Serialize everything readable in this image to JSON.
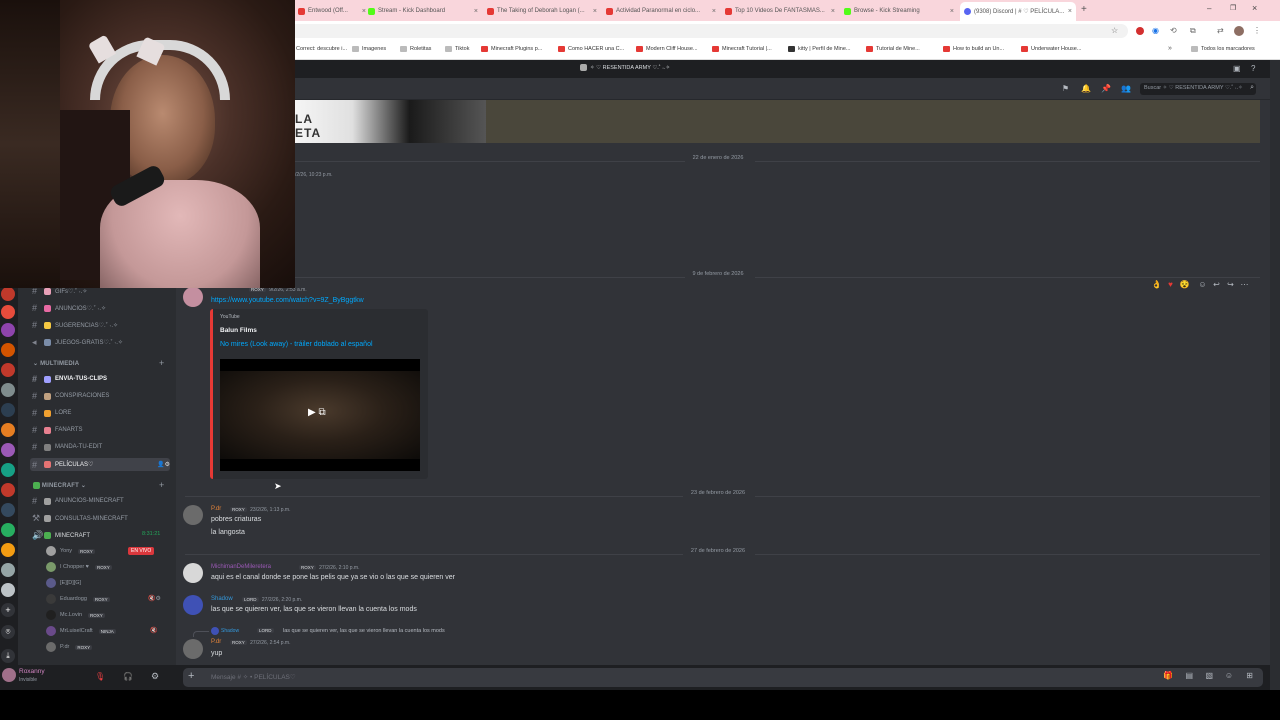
{
  "browser": {
    "tabs": [
      {
        "label": "Entwood (Off...",
        "color": "#e53935"
      },
      {
        "label": "Stream - Kick Dashboard",
        "color": "#53fc18"
      },
      {
        "label": "The Taking of Deborah Logan (...",
        "color": "#e53935"
      },
      {
        "label": "Actividad Paranormal en ciclo...",
        "color": "#e53935"
      },
      {
        "label": "Top 10 Videos De FANTASMAS...",
        "color": "#e53935"
      },
      {
        "label": "Browse - Kick Streaming",
        "color": "#53fc18"
      },
      {
        "label": "(9308) Discord | # ♡ PELÍCULA...",
        "color": "#5865f2"
      }
    ],
    "bookmarks": [
      {
        "label": "Correct: descubre i...",
        "color": "#4285f4"
      },
      {
        "label": "Imagenes",
        "color": "#888"
      },
      {
        "label": "Roletitas",
        "color": "#888"
      },
      {
        "label": "Tiktok",
        "color": "#888"
      },
      {
        "label": "Minecraft Plugins p...",
        "color": "#e53935"
      },
      {
        "label": "Como HACER una C...",
        "color": "#e53935"
      },
      {
        "label": "Modern Cliff House...",
        "color": "#e53935"
      },
      {
        "label": "Minecraft Tutorial |...",
        "color": "#e53935"
      },
      {
        "label": "kitty | Perfil de Mine...",
        "color": "#333"
      },
      {
        "label": "Tutorial de Mine...",
        "color": "#e53935"
      },
      {
        "label": "How to build an Un...",
        "color": "#e53935"
      },
      {
        "label": "Underwater House...",
        "color": "#e53935"
      }
    ],
    "all_bookmarks": "Todos los marcadores"
  },
  "discord": {
    "server_title": "✧ ♡ RESENTIDA ARMY ♡.˚ ˖.✧",
    "search_placeholder": "Buscar ✧ ♡ RESENTIDA ARMY ♡.˚ ˖.✧",
    "channels": [
      {
        "label": "GIFs♡.˚ ˖.✧",
        "emoji_color": "#e8a0b8"
      },
      {
        "label": "ANUNCIOS♡.˚ ˖.✧",
        "emoji_color": "#e86aa3"
      },
      {
        "label": "SUGERENCIAS♡.˚ ˖.✧",
        "emoji_color": "#f5c842"
      },
      {
        "label": "JUEGOS-GRATIS♡.˚ ˖.✧",
        "emoji_color": "#7a8ca8"
      }
    ],
    "cat_multimedia": "MULTIMEDIA",
    "multimedia_channels": [
      {
        "label": "ENVIA-TUS-CLIPS",
        "emoji_color": "#a0a0ff",
        "bold": true
      },
      {
        "label": "CONSPIRACIONES",
        "emoji_color": "#c0a080"
      },
      {
        "label": "LORE",
        "emoji_color": "#f0a030"
      },
      {
        "label": "FANARTS",
        "emoji_color": "#e88090"
      },
      {
        "label": "MANDA-TU-EDIT",
        "emoji_color": "#808080"
      },
      {
        "label": "PELÍCULAS♡",
        "emoji_color": "#e57373",
        "active": true
      }
    ],
    "cat_minecraft": "MINECRAFT",
    "minecraft_channels": [
      {
        "label": "ANUNCIOS-MINECRAFT",
        "emoji_color": "#a0a0a0"
      },
      {
        "label": "CONSULTAS-MINECRAFT",
        "emoji_color": "#a0a0a0"
      }
    ],
    "voice_channel": {
      "label": "MINECRAFT",
      "timer": "8:31:21"
    },
    "voice_users": [
      {
        "name": "Yony",
        "badge": "ROXY",
        "live": "EN VIVO"
      },
      {
        "name": "I Chopper ♥",
        "badge": "ROXY"
      },
      {
        "name": "[E][D][G]"
      },
      {
        "name": "Eduardogg",
        "badge": "ROXY"
      },
      {
        "name": "Mc.Lovin",
        "badge": "ROXY"
      },
      {
        "name": "MrLuiselCraft",
        "badge": "NINJA"
      },
      {
        "name": "P.dr",
        "badge": "ROXY"
      }
    ],
    "user_panel": {
      "name": "Roxanny",
      "status": "Invisible"
    },
    "composer_placeholder": "Mensaje # ✧ • PELÍCULAS♡",
    "dates": [
      "22 de enero de 2026",
      "9 de febrero de 2026",
      "23 de febrero de 2026",
      "27 de febrero de 2026"
    ],
    "earlier_time": "/2/26, 10:23 p.m.",
    "embed_msg": {
      "time": "9/2/26, 2:53 a.m.",
      "badge": "ROXY",
      "link": "https://www.youtube.com/watch?v=9Z_ByBggtkw",
      "provider": "YouTube",
      "author": "Balun Films",
      "title": "No mires (Look away) - tráiler doblado al español"
    },
    "messages": [
      {
        "author": "P.dr",
        "badge": "ROXY",
        "time": "23/2/26, 1:13 p.m.",
        "name_color": "#e4843a",
        "lines": [
          "pobres criaturas",
          "la langosta"
        ]
      },
      {
        "author": "MichimanDeMileretera",
        "badge": "ROXY",
        "time": "27/2/26, 2:10 p.m.",
        "name_color": "#9b59b6",
        "lines": [
          "aqui es el canal donde se pone las pelis que ya se vio o las que se quieren ver"
        ]
      },
      {
        "author": "Shadow",
        "badge": "LORD",
        "time": "27/2/26, 2:20 p.m.",
        "name_color": "#3498db",
        "lines": [
          "las que se quieren ver, las que se vieron llevan la cuenta los mods"
        ]
      },
      {
        "author": "P.dr",
        "badge": "ROXY",
        "time": "27/2/26, 2:54 p.m.",
        "name_color": "#e4843a",
        "reply": "las que se quieren ver, las que se vieron llevan la cuenta los mods",
        "reply_author": "Shadow",
        "reply_badge": "LORD",
        "lines": [
          "yup"
        ]
      }
    ]
  }
}
